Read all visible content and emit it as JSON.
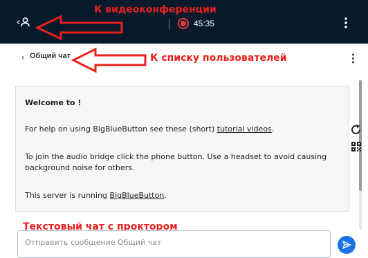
{
  "topbar": {
    "timer": "45:35",
    "colors": {
      "background": "#071a2c",
      "recording": "#e63b3b"
    }
  },
  "annotations": {
    "to_videoconference": "К видеоконференции",
    "to_user_list": "К списку пользователей",
    "text_chat_with_proctor": "Текстовый чат с проктором",
    "color": "#e8211d"
  },
  "chat": {
    "title": "Общий чат",
    "welcome": {
      "title": "Welcome to !",
      "help_prefix": "For help on using BigBlueButton see these (short) ",
      "help_link": "tutorial videos",
      "help_suffix": ".",
      "audio_text": "To join the audio bridge click the phone button. Use a headset to avoid causing background noise for others.",
      "server_prefix": "This server is running ",
      "server_link": "BigBlueButton",
      "server_suffix": "."
    },
    "input": {
      "placeholder": "Отправить сообщение Общий чат",
      "value": ""
    },
    "send_color": "#1a73e8"
  },
  "icons": [
    "user-icon",
    "recording-icon",
    "more-vertical-icon",
    "chevron-left-icon",
    "send-icon",
    "reload-icon",
    "qr-code-icon",
    "arrow-left-icon"
  ]
}
